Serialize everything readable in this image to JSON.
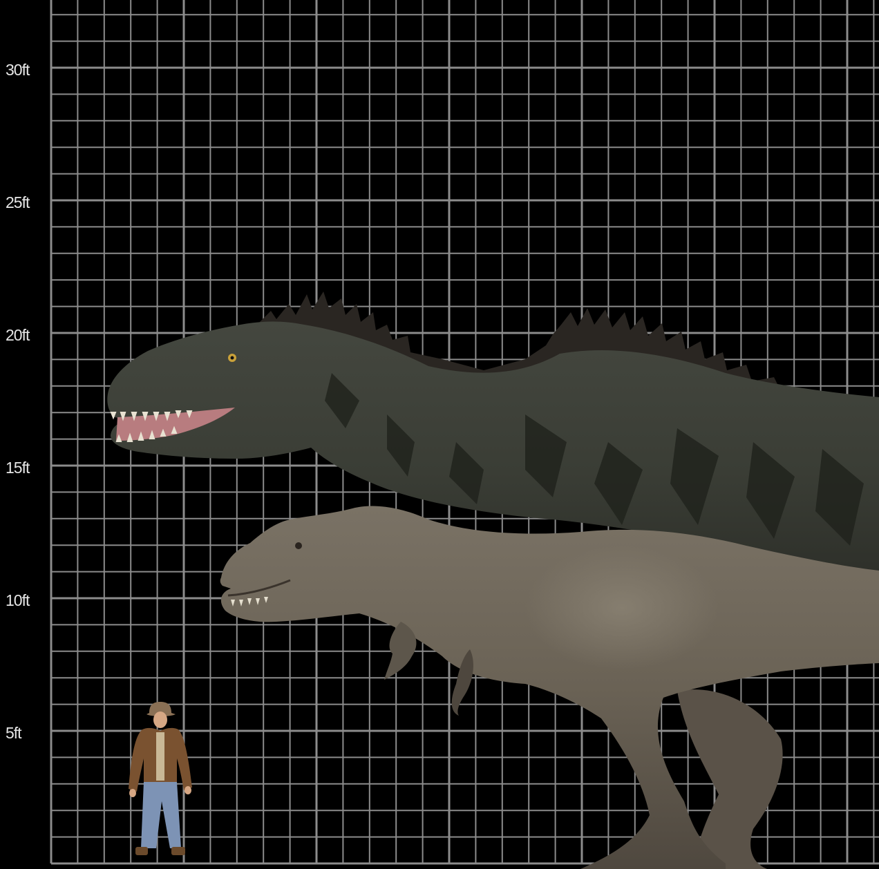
{
  "chart": {
    "y_unit": "ft",
    "y_range": [
      0,
      33
    ],
    "grid_minor_step_ft": 1,
    "grid_major_step_ft": 5,
    "grid_visible": true,
    "background_color": "#000000",
    "grid_color": "#8c8c8c",
    "label_color": "#e6e6e6"
  },
  "y_ticks": [
    {
      "value": 5,
      "label": "5ft"
    },
    {
      "value": 10,
      "label": "10ft"
    },
    {
      "value": 15,
      "label": "15ft"
    },
    {
      "value": 20,
      "label": "20ft"
    },
    {
      "value": 25,
      "label": "25ft"
    },
    {
      "value": 30,
      "label": "30ft"
    }
  ],
  "figures": [
    {
      "kind": "human",
      "icon": "person-with-hat-icon",
      "height_ft": 5.9,
      "colors": {
        "jacket": "#7a5230",
        "jeans": "#7d93b5",
        "skin": "#d6a784",
        "hat": "#8a7055"
      }
    },
    {
      "kind": "large theropod (spiked back)",
      "icon": "spiked-theropod-icon",
      "head_height_ft": 19,
      "back_height_ft": 21.5,
      "colors": {
        "body": "#3b3f36",
        "dark": "#20231d",
        "spikes": "#2a2723",
        "mouth": "#c9868a"
      }
    },
    {
      "kind": "tyrannosaur",
      "icon": "tyrannosaur-icon",
      "head_height_ft": 13,
      "hip_height_ft": 12.5,
      "colors": {
        "body": "#6e665a",
        "dark": "#3e3831",
        "light": "#8d8576"
      }
    }
  ]
}
